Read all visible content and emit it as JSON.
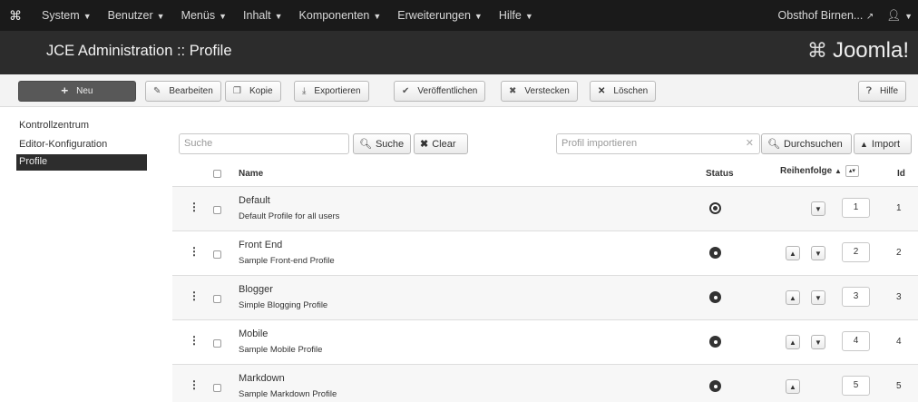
{
  "topnav": {
    "logo_icon": "joomla-icon",
    "menu": [
      "System",
      "Benutzer",
      "Menüs",
      "Inhalt",
      "Komponenten",
      "Erweiterungen",
      "Hilfe"
    ],
    "site_link": "Obsthof Birnen...",
    "user_icon": "user-icon"
  },
  "header": {
    "title": "JCE Administration :: Profile",
    "brand": "Joomla!"
  },
  "toolbar": {
    "new": "Neu",
    "edit": "Bearbeiten",
    "copy": "Kopie",
    "export": "Exportieren",
    "publish": "Veröffentlichen",
    "hide": "Verstecken",
    "delete": "Löschen",
    "help": "Hilfe"
  },
  "sidebar": {
    "items": [
      "Kontrollzentrum",
      "Editor-Konfiguration",
      "Profile"
    ],
    "active": "Profile"
  },
  "filters": {
    "search_placeholder": "Suche",
    "search_button": "Suche",
    "clear_button": "Clear",
    "import_placeholder": "Profil importieren",
    "browse_button": "Durchsuchen",
    "import_button": "Import"
  },
  "table": {
    "columns": {
      "name": "Name",
      "status": "Status",
      "ordering": "Reihenfolge",
      "id": "Id"
    },
    "rows": [
      {
        "name": "Default",
        "description": "Default Profile for all users",
        "order": "1",
        "id": "1"
      },
      {
        "name": "Front End",
        "description": "Sample Front-end Profile",
        "order": "2",
        "id": "2"
      },
      {
        "name": "Blogger",
        "description": "Simple Blogging Profile",
        "order": "3",
        "id": "3"
      },
      {
        "name": "Mobile",
        "description": "Sample Mobile Profile",
        "order": "4",
        "id": "4"
      },
      {
        "name": "Markdown",
        "description": "Sample Markdown Profile",
        "order": "5",
        "id": "5"
      }
    ]
  }
}
